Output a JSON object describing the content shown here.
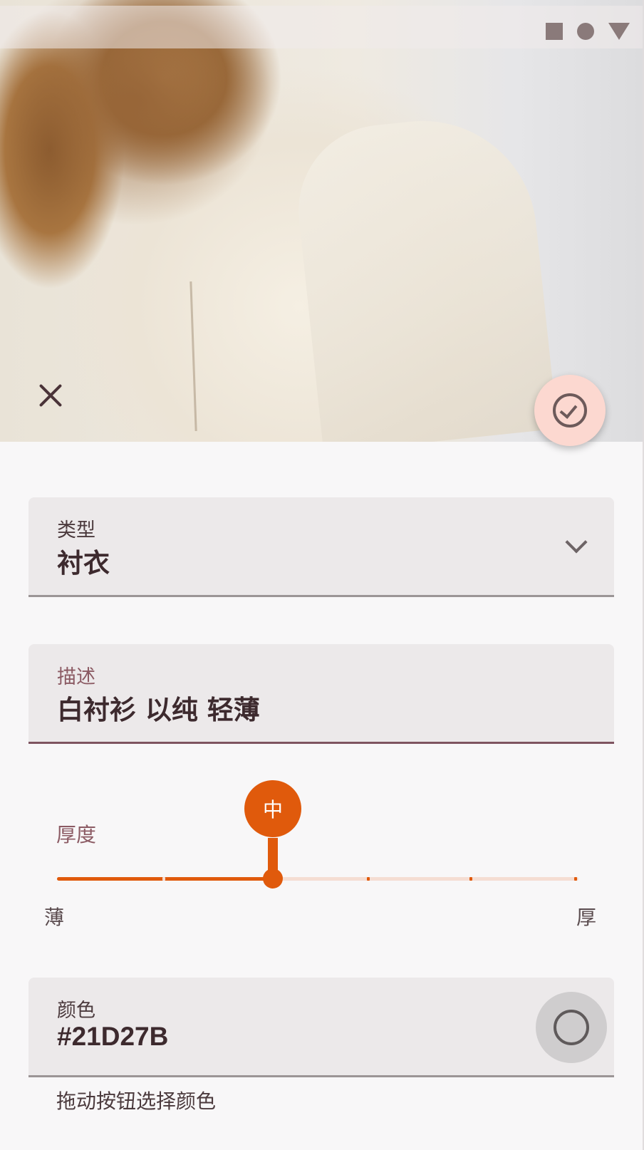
{
  "status_bar": {
    "icons": [
      "square-icon",
      "circle-icon",
      "triangle-icon"
    ]
  },
  "header": {
    "close_icon": "close-icon",
    "confirm_icon": "check-circle-icon",
    "confirm_color": "#fcd8d0"
  },
  "form": {
    "type": {
      "label": "类型",
      "value": "衬衣"
    },
    "description": {
      "label": "描述",
      "value": "白衬衫 以纯 轻薄"
    },
    "thickness": {
      "label": "厚度",
      "value": "中",
      "min_label": "薄",
      "max_label": "厚",
      "level_index": 2,
      "level_count": 5,
      "accent": "#e05a0c"
    },
    "color": {
      "label": "颜色",
      "value": "#21D27B",
      "helper": "拖动按钮选择颜色"
    }
  }
}
